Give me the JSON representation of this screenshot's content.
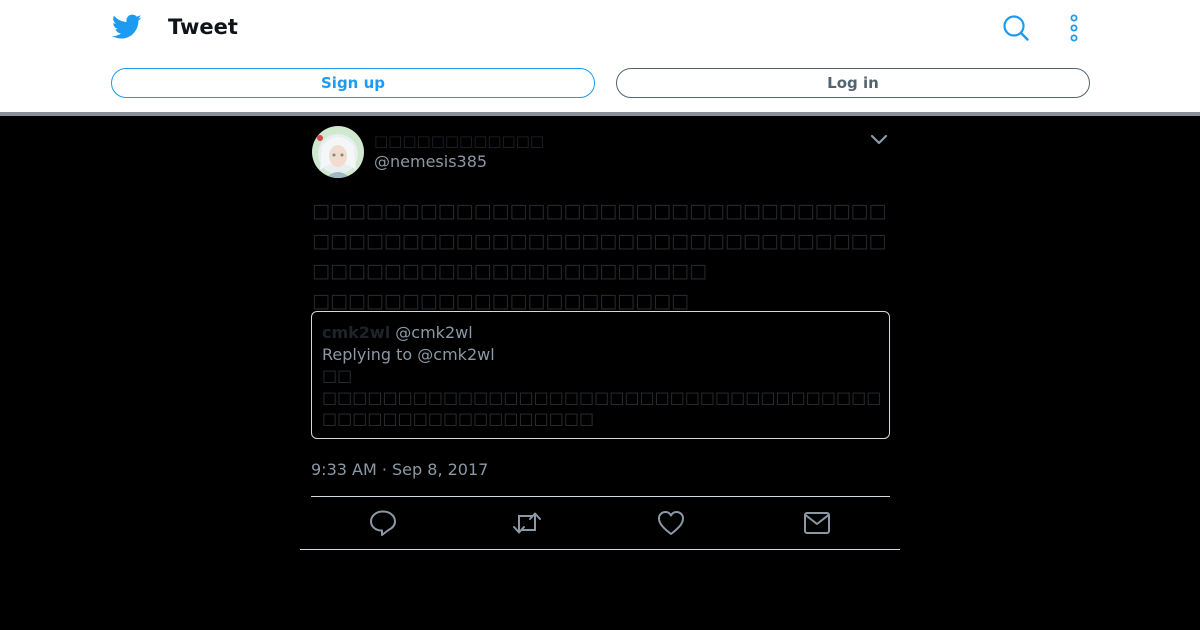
{
  "header": {
    "title": "Tweet",
    "icons": {
      "logo": "twitter-bird-icon",
      "search": "search-icon",
      "more": "more-vertical-icon"
    },
    "sign_up_label": "Sign up",
    "log_in_label": "Log in"
  },
  "tweet": {
    "display_name": "□□□□□□□□□□□□",
    "handle": "@nemesis385",
    "text": "□□□□□□□□□□□□□□□□□□□□□□□□□□□□□□□□□□□□□□□□□□□□□□□□□□□□□□□□□□□□□□□□□□□□□□□□□□□□□□□□□□□□□□\n□□□□□□□□□□□□□□□□□□□□□",
    "timestamp": "9:33 AM · Sep 8, 2017",
    "quoted": {
      "name": "cmk2wl",
      "handle": "@cmk2wl",
      "replying_to": "Replying to @cmk2wl",
      "text": "□□\n□□□□□□□□□□□□□□□□□□□□□□□□□□□□□□□□□□□□□\n□□□□□□□□□□□□□□□□□□"
    },
    "actions": [
      "reply-icon",
      "retweet-icon",
      "like-icon",
      "message-icon"
    ]
  },
  "colors": {
    "accent": "#1d9bf0",
    "background": "#000000",
    "muted_text": "#8b98a5"
  }
}
